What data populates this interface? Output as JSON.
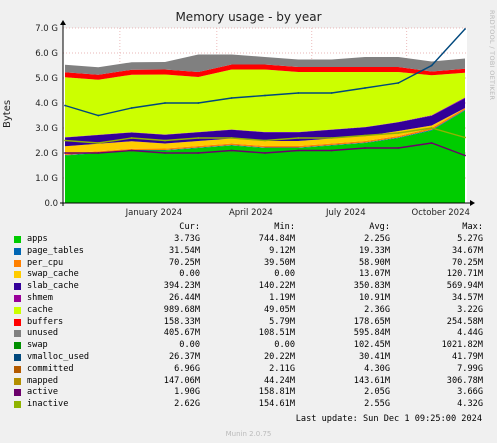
{
  "title": "Memory usage - by year",
  "side_text": "RRDTOOL / TOBI OETIKER",
  "footer": "Last update: Sun Dec  1 09:25:00 2024",
  "version": "Munin 2.0.75",
  "legend_headers": {
    "cur": "Cur:",
    "min": "Min:",
    "avg": "Avg:",
    "max": "Max:"
  },
  "legend": [
    {
      "name": "apps",
      "color": "#00cc00",
      "cur": "3.73G",
      "min": "744.84M",
      "avg": "2.25G",
      "max": "5.27G"
    },
    {
      "name": "page_tables",
      "color": "#0066b3",
      "cur": "31.54M",
      "min": "9.12M",
      "avg": "19.33M",
      "max": "34.67M"
    },
    {
      "name": "per_cpu",
      "color": "#ff8000",
      "cur": "70.25M",
      "min": "39.50M",
      "avg": "58.90M",
      "max": "70.25M"
    },
    {
      "name": "swap_cache",
      "color": "#ffcc00",
      "cur": "0.00",
      "min": "0.00",
      "avg": "13.07M",
      "max": "120.71M"
    },
    {
      "name": "slab_cache",
      "color": "#330099",
      "cur": "394.23M",
      "min": "140.22M",
      "avg": "350.83M",
      "max": "569.94M"
    },
    {
      "name": "shmem",
      "color": "#990099",
      "cur": "26.44M",
      "min": "1.19M",
      "avg": "10.91M",
      "max": "34.57M"
    },
    {
      "name": "cache",
      "color": "#ccff00",
      "cur": "989.68M",
      "min": "49.05M",
      "avg": "2.36G",
      "max": "3.22G"
    },
    {
      "name": "buffers",
      "color": "#ff0000",
      "cur": "158.33M",
      "min": "5.79M",
      "avg": "178.65M",
      "max": "254.58M"
    },
    {
      "name": "unused",
      "color": "#808080",
      "cur": "405.67M",
      "min": "108.51M",
      "avg": "595.84M",
      "max": "4.44G"
    },
    {
      "name": "swap",
      "color": "#008f00",
      "cur": "0.00",
      "min": "0.00",
      "avg": "102.45M",
      "max": "1021.82M"
    },
    {
      "name": "vmalloc_used",
      "color": "#00487d",
      "cur": "26.37M",
      "min": "20.22M",
      "avg": "30.41M",
      "max": "41.79M"
    },
    {
      "name": "committed",
      "color": "#b35a00",
      "cur": "6.96G",
      "min": "2.11G",
      "avg": "4.30G",
      "max": "7.99G"
    },
    {
      "name": "mapped",
      "color": "#b38f00",
      "cur": "147.06M",
      "min": "44.24M",
      "avg": "143.61M",
      "max": "306.78M"
    },
    {
      "name": "active",
      "color": "#6b006b",
      "cur": "1.90G",
      "min": "158.81M",
      "avg": "2.05G",
      "max": "3.66G"
    },
    {
      "name": "inactive",
      "color": "#8fb300",
      "cur": "2.62G",
      "min": "154.61M",
      "avg": "2.55G",
      "max": "4.32G"
    }
  ],
  "chart_data": {
    "type": "area",
    "title": "Memory usage - by year",
    "ylabel": "Bytes",
    "ylim": [
      0,
      7.0
    ],
    "y_unit": "G",
    "y_ticks": [
      "0.0",
      "1.0 G",
      "2.0 G",
      "3.0 G",
      "4.0 G",
      "5.0 G",
      "6.0 G",
      "7.0 G"
    ],
    "x_ticks": [
      "January 2024",
      "April 2024",
      "July 2024",
      "October 2024"
    ],
    "grid": true,
    "x": [
      "2023-12",
      "2024-01",
      "2024-02",
      "2024-03",
      "2024-04",
      "2024-05",
      "2024-06",
      "2024-07",
      "2024-08",
      "2024-09",
      "2024-10",
      "2024-11",
      "2024-12"
    ],
    "stacked_series": [
      {
        "name": "apps",
        "color": "#00cc00",
        "values": [
          1.9,
          2.0,
          2.1,
          2.1,
          2.2,
          2.3,
          2.2,
          2.2,
          2.3,
          2.4,
          2.6,
          2.9,
          3.7
        ]
      },
      {
        "name": "page_tables",
        "color": "#0066b3",
        "values": [
          0.02,
          0.02,
          0.02,
          0.02,
          0.02,
          0.02,
          0.02,
          0.02,
          0.02,
          0.02,
          0.02,
          0.03,
          0.03
        ]
      },
      {
        "name": "per_cpu",
        "color": "#ff8000",
        "values": [
          0.05,
          0.05,
          0.05,
          0.06,
          0.06,
          0.06,
          0.06,
          0.06,
          0.06,
          0.06,
          0.06,
          0.07,
          0.07
        ]
      },
      {
        "name": "swap_cache",
        "color": "#ffcc00",
        "values": [
          0.3,
          0.3,
          0.3,
          0.2,
          0.2,
          0.2,
          0.2,
          0.2,
          0.2,
          0.2,
          0.2,
          0.1,
          0.0
        ]
      },
      {
        "name": "slab_cache",
        "color": "#330099",
        "values": [
          0.35,
          0.35,
          0.35,
          0.35,
          0.35,
          0.35,
          0.35,
          0.35,
          0.35,
          0.35,
          0.35,
          0.39,
          0.39
        ]
      },
      {
        "name": "shmem",
        "color": "#990099",
        "values": [
          0.01,
          0.01,
          0.01,
          0.01,
          0.01,
          0.01,
          0.01,
          0.01,
          0.01,
          0.01,
          0.01,
          0.02,
          0.03
        ]
      },
      {
        "name": "cache",
        "color": "#ccff00",
        "values": [
          2.4,
          2.2,
          2.3,
          2.4,
          2.2,
          2.4,
          2.5,
          2.4,
          2.3,
          2.2,
          2.0,
          1.6,
          0.99
        ]
      },
      {
        "name": "buffers",
        "color": "#ff0000",
        "values": [
          0.2,
          0.2,
          0.2,
          0.2,
          0.2,
          0.2,
          0.2,
          0.2,
          0.2,
          0.2,
          0.2,
          0.15,
          0.16
        ]
      },
      {
        "name": "unused",
        "color": "#808080",
        "values": [
          0.3,
          0.3,
          0.3,
          0.3,
          0.7,
          0.4,
          0.3,
          0.3,
          0.3,
          0.4,
          0.4,
          0.4,
          0.41
        ]
      }
    ],
    "line_series": [
      {
        "name": "committed",
        "color": "#00487d",
        "values": [
          3.9,
          3.5,
          3.8,
          4.0,
          4.0,
          4.2,
          4.3,
          4.4,
          4.4,
          4.6,
          4.8,
          5.5,
          6.96
        ]
      },
      {
        "name": "active",
        "color": "#6b006b",
        "values": [
          2.0,
          2.0,
          2.1,
          2.0,
          2.0,
          2.1,
          2.0,
          2.1,
          2.1,
          2.2,
          2.2,
          2.4,
          1.9
        ]
      },
      {
        "name": "inactive",
        "color": "#8fb300",
        "values": [
          2.5,
          2.4,
          2.6,
          2.5,
          2.6,
          2.6,
          2.5,
          2.6,
          2.6,
          2.7,
          2.8,
          3.0,
          2.62
        ]
      }
    ]
  }
}
